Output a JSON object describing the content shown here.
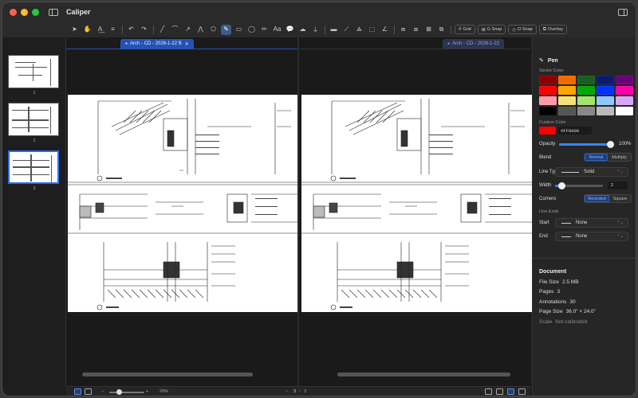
{
  "app": {
    "title": "Caliper"
  },
  "toolbar": {
    "tools": [
      {
        "name": "select-tool-icon",
        "glyph": "➤"
      },
      {
        "name": "hand-tool-icon",
        "glyph": "✋"
      },
      {
        "name": "text-select-tool-icon",
        "glyph": "A͟"
      },
      {
        "name": "edit-text-tool-icon",
        "glyph": "≡"
      },
      {
        "name": "undo-icon",
        "glyph": "↶"
      },
      {
        "name": "redo-icon",
        "glyph": "↷"
      },
      {
        "name": "line-tool-icon",
        "glyph": "╱"
      },
      {
        "name": "arc-tool-icon",
        "glyph": "⌒"
      },
      {
        "name": "arrow-tool-icon",
        "glyph": "↗"
      },
      {
        "name": "polyline-tool-icon",
        "glyph": "⋀"
      },
      {
        "name": "polygon-tool-icon",
        "glyph": "⬠"
      },
      {
        "name": "pen-tool-icon",
        "glyph": "✎"
      },
      {
        "name": "rectangle-tool-icon",
        "glyph": "▭"
      },
      {
        "name": "ellipse-tool-icon",
        "glyph": "◯"
      },
      {
        "name": "highlighter-tool-icon",
        "glyph": "✏"
      },
      {
        "name": "text-tool-icon",
        "glyph": "Aa"
      },
      {
        "name": "callout-tool-icon",
        "glyph": "💬"
      },
      {
        "name": "cloud-tool-icon",
        "glyph": "☁"
      },
      {
        "name": "stamp-tool-icon",
        "glyph": "⍊"
      },
      {
        "name": "length-measure-icon",
        "glyph": "▬"
      },
      {
        "name": "polylength-measure-icon",
        "glyph": "⟋"
      },
      {
        "name": "area-measure-icon",
        "glyph": "⟁"
      },
      {
        "name": "rect-area-measure-icon",
        "glyph": "⬚"
      },
      {
        "name": "angle-measure-icon",
        "glyph": "∠"
      },
      {
        "name": "crop-tool-icon",
        "glyph": "⧈"
      },
      {
        "name": "snapshot-tool-icon",
        "glyph": "⧇"
      },
      {
        "name": "compare-tool-icon",
        "glyph": "⊠"
      },
      {
        "name": "overlay-compare-icon",
        "glyph": "⧉"
      }
    ],
    "buttons": {
      "grid": "Grid",
      "gsnap": "G Snap",
      "osnap": "O Snap",
      "overlay": "Overlay"
    }
  },
  "thumbnails": [
    {
      "number": "1"
    },
    {
      "number": "2"
    },
    {
      "number": "3"
    }
  ],
  "tabs": {
    "left": "Arch - CD - 2026-1-22 B",
    "right": "Arch - CD - 2026-1-22"
  },
  "statusbar": {
    "zoom_minus": "−",
    "zoom_plus": "+",
    "zoom_percent": "29%",
    "zoom_level": 0.29,
    "prev": "‹",
    "next": "›",
    "current_page": "3",
    "total_pages": "3"
  },
  "inspector": {
    "tool_name": "Pen",
    "stroke_color_label": "Stroke Color",
    "swatches": [
      "#8b0000",
      "#f06a00",
      "#1b5e20",
      "#0b1a6e",
      "#6a0080",
      "#ff0000",
      "#ffa500",
      "#00aa00",
      "#0033ff",
      "#ff00aa",
      "#ff9aa8",
      "#f5e27a",
      "#a6e36a",
      "#8ec7ff",
      "#d9a6f5",
      "#000000",
      "#555555",
      "#888888",
      "#bbbbbb",
      "#ffffff"
    ],
    "custom_color_label": "Custom Color",
    "custom_color": "#FF0000",
    "opacity_label": "Opacity",
    "opacity_value": "100%",
    "opacity_level": 1.0,
    "blend_label": "Blend",
    "blend_options": [
      "Normal",
      "Multiply"
    ],
    "line_type_label": "Line Type",
    "line_type_value": "Solid",
    "width_label": "Width",
    "width_value": "2",
    "corners_label": "Corners",
    "corners_options": [
      "Rounded",
      "Square"
    ],
    "line_ends_label": "Line Ends",
    "start_label": "Start",
    "start_value": "None",
    "end_label": "End",
    "end_value": "None",
    "document": {
      "title": "Document",
      "file_size_label": "File Size",
      "file_size": "2.5 MB",
      "pages_label": "Pages",
      "pages": "3",
      "annotations_label": "Annotations",
      "annotations": "30",
      "page_size_label": "Page Size",
      "page_size": "36.0\" × 24.0\"",
      "scale_label": "Scale",
      "scale": "Not calibrated"
    }
  }
}
